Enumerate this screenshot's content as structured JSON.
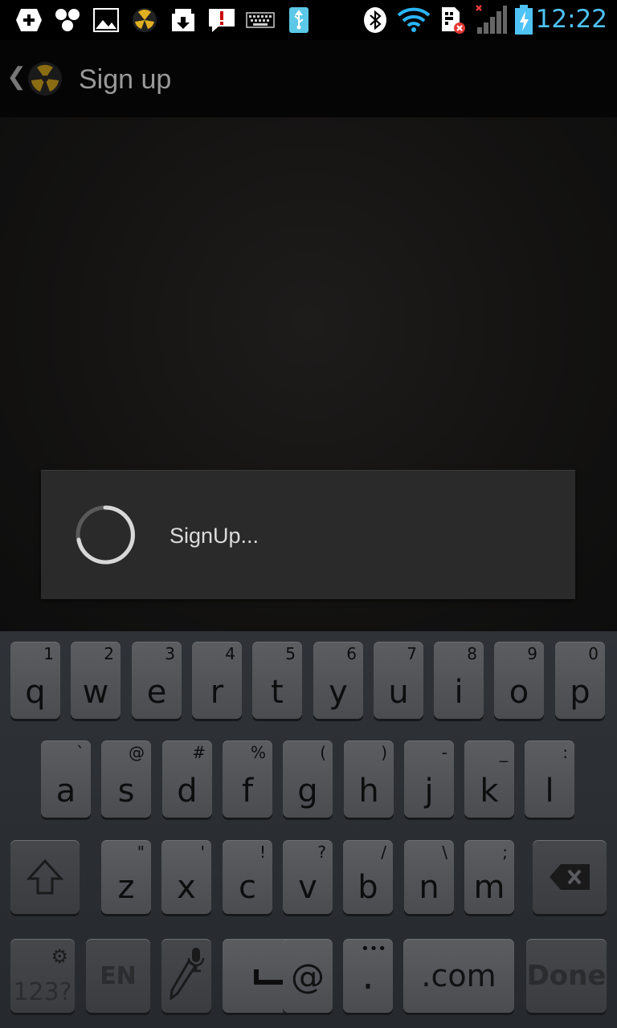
{
  "status_bar": {
    "time": "12:22",
    "icons": [
      "plus-icon",
      "molecule-icon",
      "image-icon",
      "radiation-app-icon",
      "download-icon",
      "alert-icon",
      "keyboard-icon",
      "usb-icon",
      "bluetooth-icon",
      "wifi-icon",
      "sim-error-icon",
      "signal-icon",
      "battery-charging-icon"
    ]
  },
  "action_bar": {
    "title": "Sign up"
  },
  "dialog": {
    "message": "SignUp..."
  },
  "keyboard": {
    "row1": [
      {
        "key": "q",
        "sub": "1"
      },
      {
        "key": "w",
        "sub": "2"
      },
      {
        "key": "e",
        "sub": "3"
      },
      {
        "key": "r",
        "sub": "4"
      },
      {
        "key": "t",
        "sub": "5"
      },
      {
        "key": "y",
        "sub": "6"
      },
      {
        "key": "u",
        "sub": "7"
      },
      {
        "key": "i",
        "sub": "8"
      },
      {
        "key": "o",
        "sub": "9"
      },
      {
        "key": "p",
        "sub": "0"
      }
    ],
    "row2": [
      {
        "key": "a",
        "sub": "`"
      },
      {
        "key": "s",
        "sub": "@"
      },
      {
        "key": "d",
        "sub": "#"
      },
      {
        "key": "f",
        "sub": "%"
      },
      {
        "key": "g",
        "sub": "("
      },
      {
        "key": "h",
        "sub": ")"
      },
      {
        "key": "j",
        "sub": "-"
      },
      {
        "key": "k",
        "sub": "_"
      },
      {
        "key": "l",
        "sub": ":"
      }
    ],
    "row3": [
      {
        "key": "z",
        "sub": "\""
      },
      {
        "key": "x",
        "sub": "'"
      },
      {
        "key": "c",
        "sub": "!"
      },
      {
        "key": "v",
        "sub": "?"
      },
      {
        "key": "b",
        "sub": "/"
      },
      {
        "key": "n",
        "sub": "\\"
      },
      {
        "key": "m",
        "sub": ";"
      }
    ],
    "symbols_label": "123?",
    "lang_label": "EN",
    "at_label": "@",
    "period_label": ".",
    "dotcom_label": ".com",
    "done_label": "Done"
  }
}
